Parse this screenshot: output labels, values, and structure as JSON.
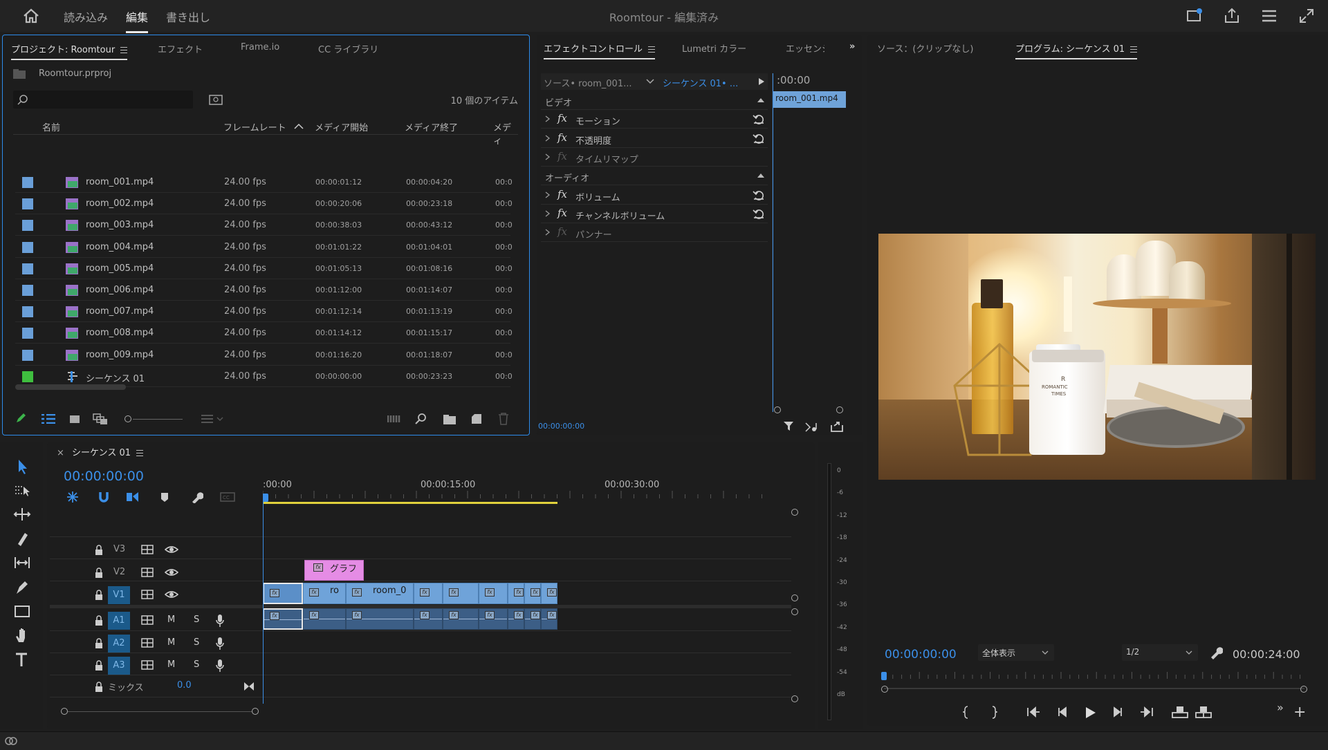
{
  "topbar": {
    "nav": [
      "読み込み",
      "編集",
      "書き出し"
    ],
    "active": "編集",
    "title": "Roomtour - 編集済み"
  },
  "project": {
    "tabs": [
      "プロジェクト: Roomtour",
      "エフェクト",
      "Frame.io",
      "CC ライブラリ"
    ],
    "file": "Roomtour.prproj",
    "item_count": "10 個のアイテム",
    "columns": [
      "名前",
      "フレームレート",
      "メディア開始",
      "メディア終了",
      "メディ"
    ],
    "rows": [
      {
        "name": "room_001.mp4",
        "fps": "24.00 fps",
        "start": "00:00:01:12",
        "end": "00:00:04:20",
        "extra": "00:0"
      },
      {
        "name": "room_002.mp4",
        "fps": "24.00 fps",
        "start": "00:00:20:06",
        "end": "00:00:23:18",
        "extra": "00:0"
      },
      {
        "name": "room_003.mp4",
        "fps": "24.00 fps",
        "start": "00:00:38:03",
        "end": "00:00:43:12",
        "extra": "00:0"
      },
      {
        "name": "room_004.mp4",
        "fps": "24.00 fps",
        "start": "00:01:01:22",
        "end": "00:01:04:01",
        "extra": "00:0"
      },
      {
        "name": "room_005.mp4",
        "fps": "24.00 fps",
        "start": "00:01:05:13",
        "end": "00:01:08:16",
        "extra": "00:0"
      },
      {
        "name": "room_006.mp4",
        "fps": "24.00 fps",
        "start": "00:01:12:00",
        "end": "00:01:14:07",
        "extra": "00:0"
      },
      {
        "name": "room_007.mp4",
        "fps": "24.00 fps",
        "start": "00:01:12:14",
        "end": "00:01:13:19",
        "extra": "00:0"
      },
      {
        "name": "room_008.mp4",
        "fps": "24.00 fps",
        "start": "00:01:14:12",
        "end": "00:01:15:17",
        "extra": "00:0"
      },
      {
        "name": "room_009.mp4",
        "fps": "24.00 fps",
        "start": "00:01:16:20",
        "end": "00:01:18:07",
        "extra": "00:0"
      },
      {
        "name": "シーケンス 01",
        "fps": "24.00 fps",
        "start": "00:00:00:00",
        "end": "00:00:23:23",
        "extra": "00:0"
      }
    ]
  },
  "effects": {
    "tabs": [
      "エフェクトコントロール",
      "Lumetri カラー",
      "エッセンシ"
    ],
    "source": "ソース• room_001...",
    "sequence": "シーケンス 01• ...",
    "ruler_time": ":00:00",
    "clip_label": "room_001.mp4",
    "video_header": "ビデオ",
    "audio_header": "オーディオ",
    "video_items": [
      "モーション",
      "不透明度",
      "タイムリマップ"
    ],
    "audio_items": [
      "ボリューム",
      "チャンネルボリューム",
      "パンナー"
    ],
    "timecode": "00:00:00:00"
  },
  "program": {
    "source_tab": "ソース：(クリップなし)",
    "program_tab": "プログラム: シーケンス 01",
    "timecode": "00:00:00:00",
    "fit": "全体表示",
    "resolution": "1/2",
    "duration": "00:00:24:00",
    "label_r": "R",
    "label_romantic": "ROMANTIC",
    "label_times": "TIMES"
  },
  "timeline": {
    "tab": "シーケンス 01",
    "timecode": "00:00:00:00",
    "ruler": [
      ":00:00",
      "00:00:15:00",
      "00:00:30:00"
    ],
    "video_tracks": [
      "V3",
      "V2",
      "V1"
    ],
    "audio_tracks": [
      "A1",
      "A2",
      "A3"
    ],
    "mix_label": "ミックス",
    "mix_value": "0.0",
    "m": "M",
    "s": "S",
    "graphic_clip": "グラフ",
    "clip_ro": "ro",
    "clip_room0": "room_0",
    "fx": "fx"
  },
  "meter": {
    "labels": [
      "0",
      "-6",
      "-12",
      "-18",
      "-24",
      "-30",
      "-36",
      "-42",
      "-48",
      "-54",
      "dB"
    ]
  }
}
